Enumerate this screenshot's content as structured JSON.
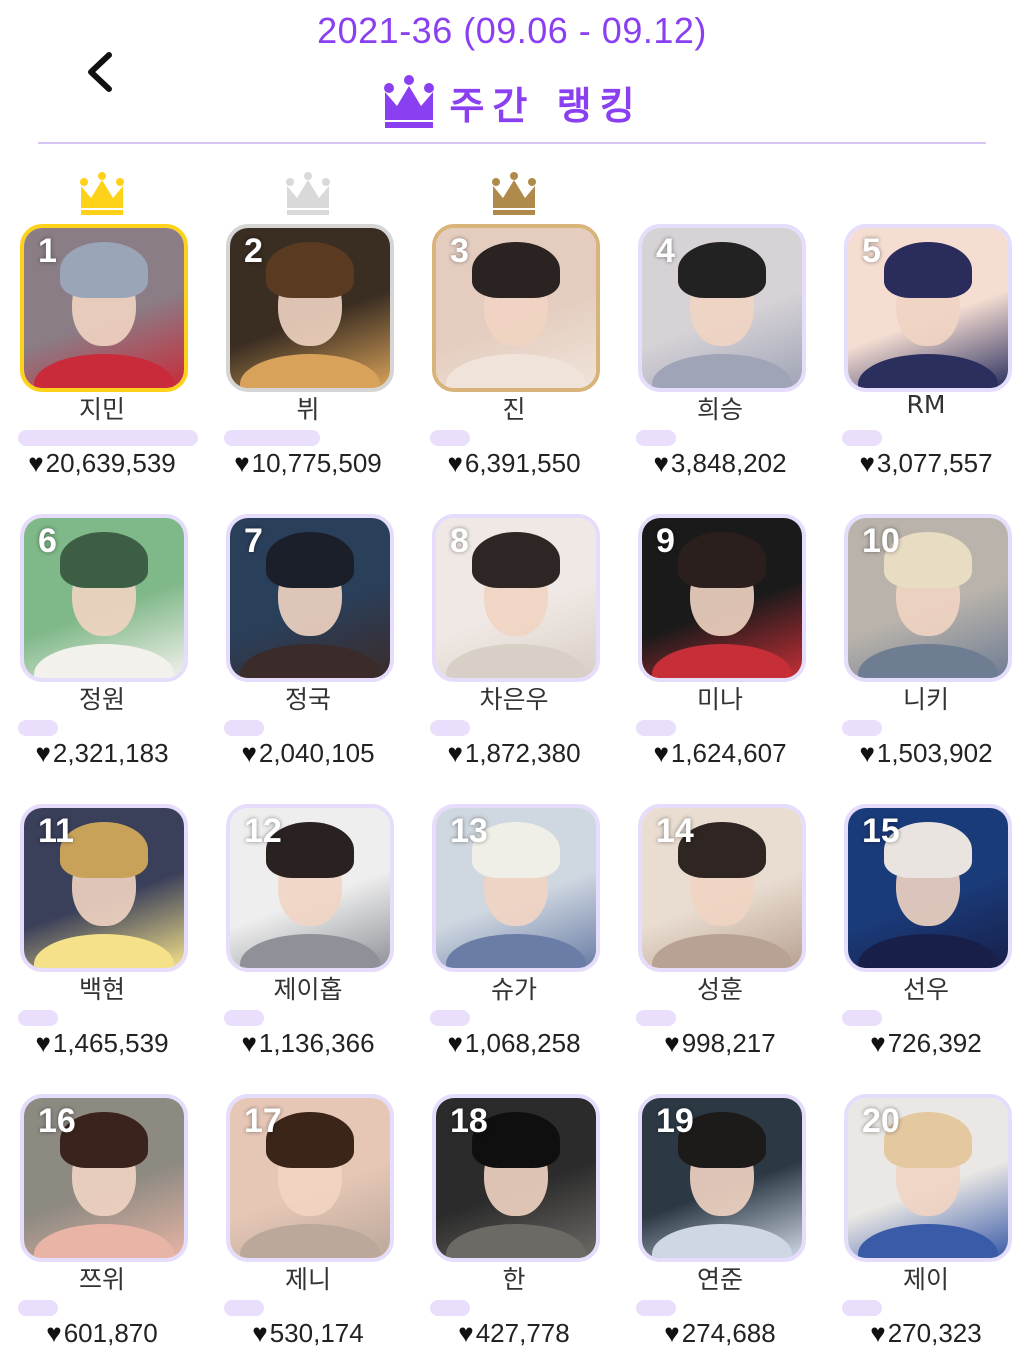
{
  "header": {
    "week": "2021-36 (09.06 - 09.12)",
    "title": "주간 랭킹",
    "back_icon": "chevron-left-icon",
    "title_icon": "crown-icon",
    "accent": "#8a3ff0"
  },
  "rankings": [
    {
      "rank": "1",
      "name": "지민",
      "votes": "20,639,539",
      "medal": "gold",
      "colors": [
        "#8a7d86",
        "#9aa5b7",
        "#c92b3b"
      ]
    },
    {
      "rank": "2",
      "name": "뷔",
      "votes": "10,775,509",
      "medal": "silver",
      "colors": [
        "#3a2d22",
        "#5a3b22",
        "#d9a25a"
      ]
    },
    {
      "rank": "3",
      "name": "진",
      "votes": "6,391,550",
      "medal": "bronze",
      "colors": [
        "#e4cdbf",
        "#2a2321",
        "#f0e3da"
      ]
    },
    {
      "rank": "4",
      "name": "희승",
      "votes": "3,848,202",
      "medal": "none",
      "colors": [
        "#d6d2d6",
        "#222222",
        "#9fa4b6"
      ]
    },
    {
      "rank": "5",
      "name": "RM",
      "votes": "3,077,557",
      "medal": "none",
      "colors": [
        "#f5ddd2",
        "#2a2d5b",
        "#2b2f5e"
      ]
    },
    {
      "rank": "6",
      "name": "정원",
      "votes": "2,321,183",
      "medal": "none",
      "colors": [
        "#7fb889",
        "#3d5d45",
        "#f3f1ec"
      ]
    },
    {
      "rank": "7",
      "name": "정국",
      "votes": "2,040,105",
      "medal": "none",
      "colors": [
        "#2a3f5a",
        "#1a1f2a",
        "#3b2b2a"
      ]
    },
    {
      "rank": "8",
      "name": "차은우",
      "votes": "1,872,380",
      "medal": "none",
      "colors": [
        "#f0e8e4",
        "#2d2624",
        "#d8cfc6"
      ]
    },
    {
      "rank": "9",
      "name": "미나",
      "votes": "1,624,607",
      "medal": "none",
      "colors": [
        "#1a1a1a",
        "#2b1f1e",
        "#c62f37"
      ]
    },
    {
      "rank": "10",
      "name": "니키",
      "votes": "1,503,902",
      "medal": "none",
      "colors": [
        "#b9b3ab",
        "#e8dcc2",
        "#6f7d93"
      ]
    },
    {
      "rank": "11",
      "name": "백현",
      "votes": "1,465,539",
      "medal": "none",
      "colors": [
        "#3a3f5a",
        "#c9a25a",
        "#f4e18a"
      ]
    },
    {
      "rank": "12",
      "name": "제이홉",
      "votes": "1,136,366",
      "medal": "none",
      "colors": [
        "#eeeeee",
        "#2a2220",
        "#8e9197"
      ]
    },
    {
      "rank": "13",
      "name": "슈가",
      "votes": "1,068,258",
      "medal": "none",
      "colors": [
        "#cfd7e0",
        "#f0efe7",
        "#6a7da6"
      ]
    },
    {
      "rank": "14",
      "name": "성훈",
      "votes": "998,217",
      "medal": "none",
      "colors": [
        "#e9dcd0",
        "#2f2522",
        "#b8a293"
      ]
    },
    {
      "rank": "15",
      "name": "선우",
      "votes": "726,392",
      "medal": "none",
      "colors": [
        "#1a3b7a",
        "#e9e4df",
        "#18204a"
      ]
    },
    {
      "rank": "16",
      "name": "쯔위",
      "votes": "601,870",
      "medal": "none",
      "colors": [
        "#8d8a82",
        "#3a231c",
        "#e7b4a5"
      ]
    },
    {
      "rank": "17",
      "name": "제니",
      "votes": "530,174",
      "medal": "none",
      "colors": [
        "#e6c7b6",
        "#3b2418",
        "#bba89b"
      ]
    },
    {
      "rank": "18",
      "name": "한",
      "votes": "427,778",
      "medal": "none",
      "colors": [
        "#2b2b2b",
        "#0f0f0f",
        "#6d6a66"
      ]
    },
    {
      "rank": "19",
      "name": "연준",
      "votes": "274,688",
      "medal": "none",
      "colors": [
        "#2c3945",
        "#1d1a1a",
        "#cfd7e5"
      ]
    },
    {
      "rank": "20",
      "name": "제이",
      "votes": "270,323",
      "medal": "none",
      "colors": [
        "#eae7e4",
        "#e3c8a0",
        "#3a5ba8"
      ]
    }
  ],
  "heart_icon": "heart-icon",
  "medal_colors": {
    "gold": "#ffd21a",
    "silver": "#d9d9d9",
    "bronze": "#b08a4a"
  }
}
